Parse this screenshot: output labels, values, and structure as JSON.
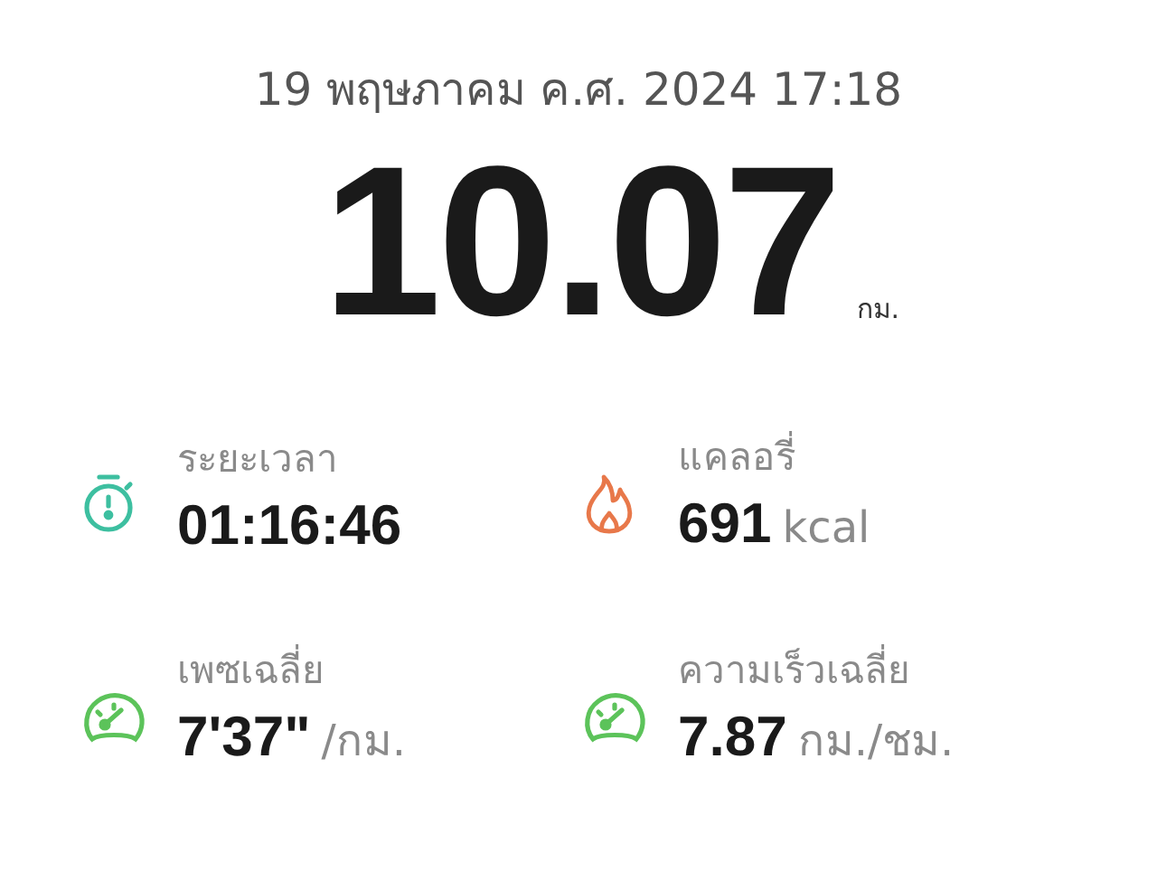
{
  "date": "19 พฤษภาคม ค.ศ. 2024 17:18",
  "distance": {
    "value": "10.07",
    "unit": "กม."
  },
  "stats": [
    {
      "kind": "stopwatch",
      "color": "#3dbfa0",
      "label": "ระยะเวลา",
      "value": "01:16:46"
    },
    {
      "kind": "flame",
      "color": "#e8784a",
      "label": "แคลอรี่",
      "value": "691",
      "unit": "kcal"
    },
    {
      "kind": "gauge",
      "color": "#5cc35a",
      "label": "เพซเฉลี่ย",
      "value": "7'37\"",
      "unit": "/กม."
    },
    {
      "kind": "gauge",
      "color": "#5cc35a",
      "label": "ความเร็วเฉลี่ย",
      "value": "7.87",
      "unit": "กม./ชม."
    }
  ]
}
